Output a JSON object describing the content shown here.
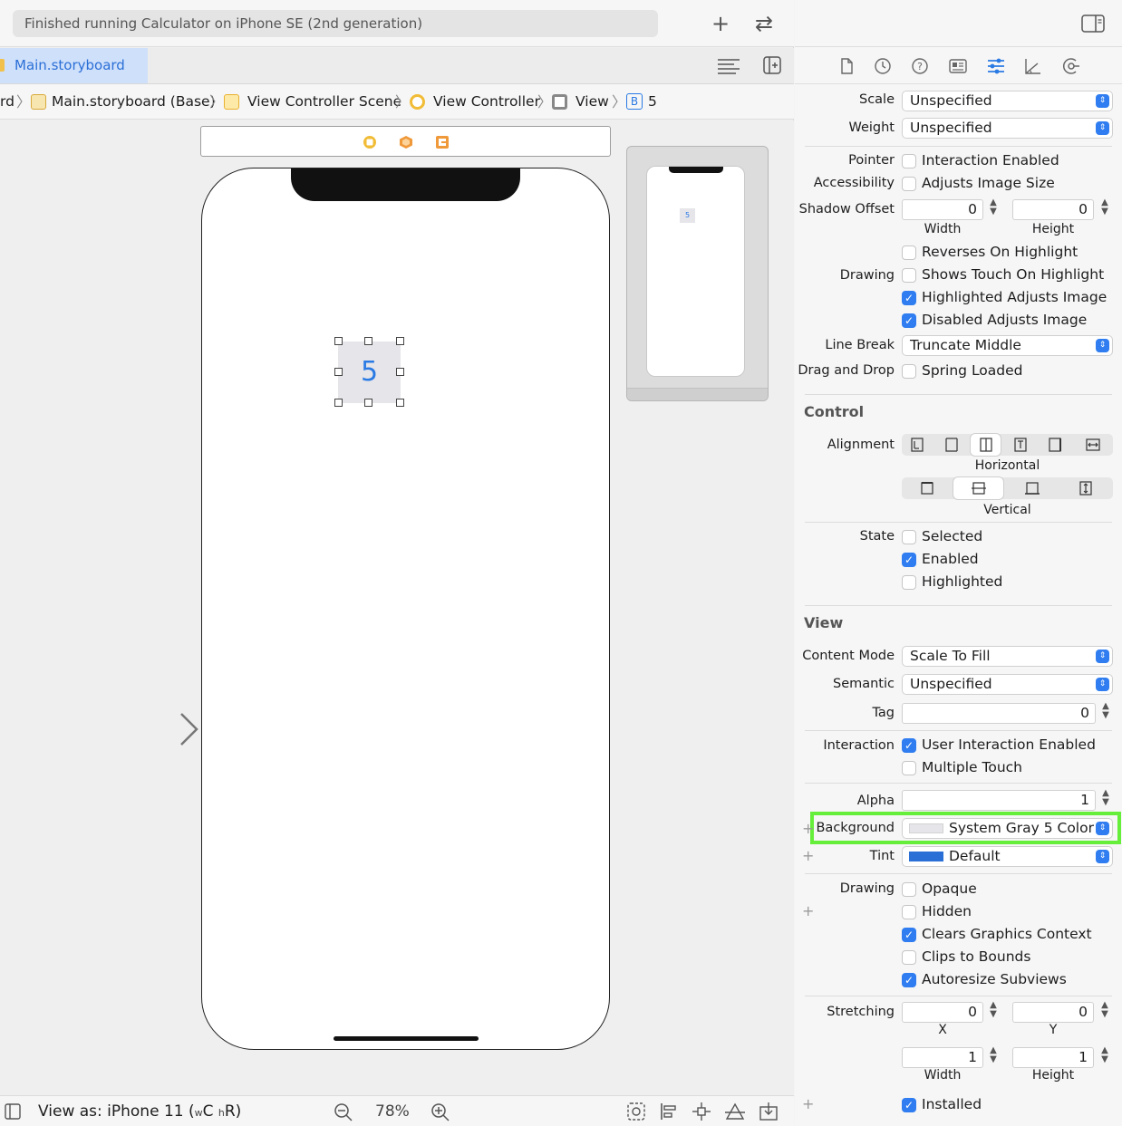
{
  "toolbar": {
    "status": "Finished running Calculator on iPhone SE (2nd generation)",
    "plus_glyph": "+",
    "swap_glyph": "⇄"
  },
  "tab": {
    "label": "Main.storyboard"
  },
  "breadcrumb": {
    "items": [
      "rd",
      "Main.storyboard (Base)",
      "View Controller Scene",
      "View Controller",
      "View",
      "5"
    ],
    "badge": "B"
  },
  "canvas": {
    "button_title": "5",
    "mini_button_title": "5"
  },
  "bottom_bar": {
    "view_as_prefix": "View as: iPhone 11 (",
    "w_small": "w",
    "w_class": "C",
    "h_small": "h",
    "h_class": "R)",
    "zoom": "78%"
  },
  "inspector": {
    "font": {
      "scale_label": "Scale",
      "scale_value": "Unspecified",
      "weight_label": "Weight",
      "weight_value": "Unspecified"
    },
    "button": {
      "pointer_label": "Pointer",
      "pointer_text": "Interaction Enabled",
      "pointer_checked": false,
      "accessibility_label": "Accessibility",
      "accessibility_text": "Adjusts Image Size",
      "accessibility_checked": false,
      "shadow_label": "Shadow Offset",
      "shadow_width": "0",
      "shadow_height": "0",
      "width_label": "Width",
      "height_label": "Height",
      "drawing_label": "Drawing",
      "reverses": "Reverses On Highlight",
      "shows_touch": "Shows Touch On Highlight",
      "highlighted_adjusts": "Highlighted Adjusts Image",
      "disabled_adjusts": "Disabled Adjusts Image",
      "linebreak_label": "Line Break",
      "linebreak_value": "Truncate Middle",
      "dragdrop_label": "Drag and Drop",
      "spring_loaded": "Spring Loaded"
    },
    "control": {
      "title": "Control",
      "alignment_label": "Alignment",
      "horizontal_label": "Horizontal",
      "vertical_label": "Vertical",
      "state_label": "State",
      "selected": "Selected",
      "enabled": "Enabled",
      "highlighted": "Highlighted"
    },
    "view": {
      "title": "View",
      "content_mode_label": "Content Mode",
      "content_mode_value": "Scale To Fill",
      "semantic_label": "Semantic",
      "semantic_value": "Unspecified",
      "tag_label": "Tag",
      "tag_value": "0",
      "interaction_label": "Interaction",
      "user_interaction": "User Interaction Enabled",
      "multiple_touch": "Multiple Touch",
      "alpha_label": "Alpha",
      "alpha_value": "1",
      "background_label": "Background",
      "background_value": "System Gray 5 Color",
      "tint_label": "Tint",
      "tint_value": "Default",
      "drawing_label": "Drawing",
      "opaque": "Opaque",
      "hidden": "Hidden",
      "clears_graphics": "Clears Graphics Context",
      "clips_to_bounds": "Clips to Bounds",
      "autoresize": "Autoresize Subviews",
      "stretching_label": "Stretching",
      "stretch_x": "0",
      "stretch_y": "0",
      "x_label": "X",
      "y_label": "Y",
      "stretch_w": "1",
      "stretch_h": "1",
      "width_label": "Width",
      "height_label": "Height",
      "installed": "Installed"
    }
  },
  "colors": {
    "accent": "#2f7df0",
    "highlight_box": "#66ef3a",
    "button_bg": "#e5e5ea",
    "tint_swatch": "#2a6fd6"
  },
  "checkmark": "✓",
  "chevron": "⇕"
}
